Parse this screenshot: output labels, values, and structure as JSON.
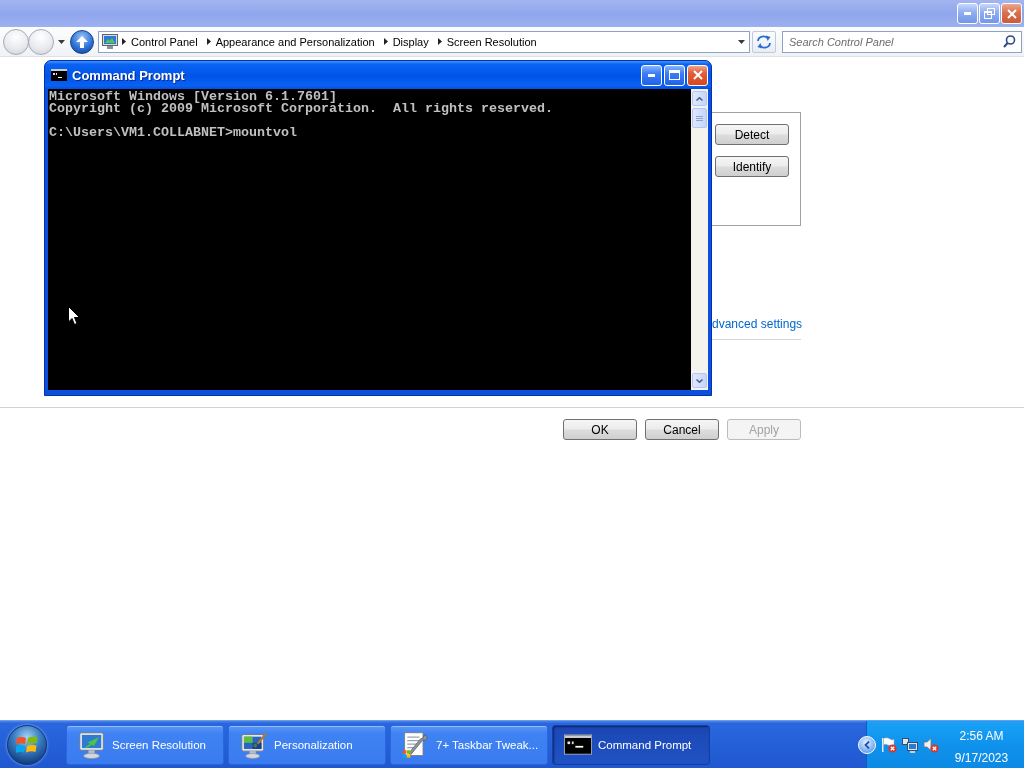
{
  "explorer": {
    "breadcrumbs": [
      "Control Panel",
      "Appearance and Personalization",
      "Display",
      "Screen Resolution"
    ],
    "search": {
      "placeholder": "Search Control Panel"
    }
  },
  "display_settings": {
    "side_buttons": [
      "Detect",
      "Identify"
    ],
    "link": "dvanced settings",
    "dialog_buttons": [
      {
        "label": "OK",
        "disabled": false
      },
      {
        "label": "Cancel",
        "disabled": false
      },
      {
        "label": "Apply",
        "disabled": true
      }
    ]
  },
  "command_prompt": {
    "title": "Command Prompt",
    "output": [
      "Microsoft Windows [Version 6.1.7601]",
      "Copyright (c) 2009 Microsoft Corporation.  All rights reserved."
    ],
    "prompt_line": "C:\\Users\\VM1.COLLABNET>mountvol"
  },
  "taskbar": {
    "tasks": [
      {
        "label": "Screen Resolution",
        "kind": "display",
        "selected": false
      },
      {
        "label": "Personalization",
        "kind": "personalize",
        "selected": false
      },
      {
        "label": "7+ Taskbar Tweak...",
        "kind": "tweaker",
        "selected": false
      },
      {
        "label": "Command Prompt",
        "kind": "console",
        "selected": true
      }
    ],
    "clock": {
      "time": "2:56 AM",
      "date": "9/17/2023"
    }
  }
}
